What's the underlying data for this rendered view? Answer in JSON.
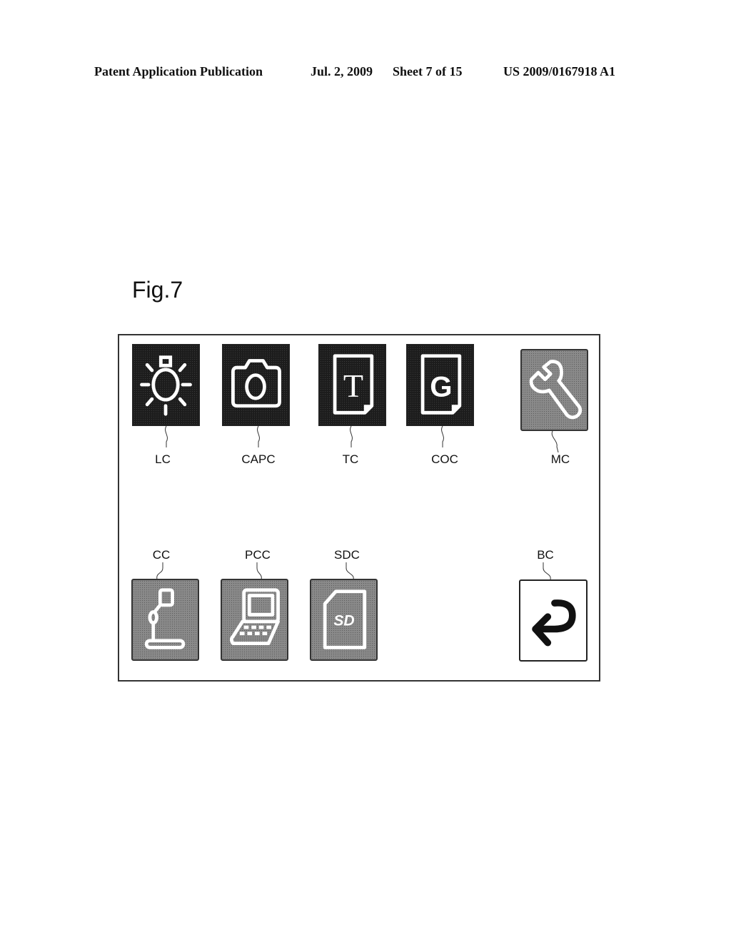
{
  "header": {
    "publication": "Patent Application Publication",
    "date": "Jul. 2, 2009",
    "sheet": "Sheet 7 of 15",
    "number": "US 2009/0167918 A1"
  },
  "figure": {
    "title": "Fig.7"
  },
  "icons": [
    {
      "id": "LC",
      "label": "LC",
      "icon": "light-bulb-icon",
      "style": "dark"
    },
    {
      "id": "CAPC",
      "label": "CAPC",
      "icon": "camera-icon",
      "style": "dark"
    },
    {
      "id": "TC",
      "label": "TC",
      "icon": "text-document-icon",
      "style": "dark",
      "glyph": "T"
    },
    {
      "id": "COC",
      "label": "COC",
      "icon": "graphic-document-icon",
      "style": "dark",
      "glyph": "G"
    },
    {
      "id": "MC",
      "label": "MC",
      "icon": "wrench-icon",
      "style": "grey"
    },
    {
      "id": "CC",
      "label": "CC",
      "icon": "document-camera-icon",
      "style": "grey"
    },
    {
      "id": "PCC",
      "label": "PCC",
      "icon": "computer-icon",
      "style": "grey"
    },
    {
      "id": "SDC",
      "label": "SDC",
      "icon": "sd-card-icon",
      "style": "grey",
      "glyph": "SD"
    },
    {
      "id": "BC",
      "label": "BC",
      "icon": "back-arrow-icon",
      "style": "white"
    }
  ],
  "colors": {
    "dark_tile": "#1c1c1c",
    "grey_tile": "#8a8a8a",
    "stroke": "#ffffff",
    "border": "#222222"
  }
}
